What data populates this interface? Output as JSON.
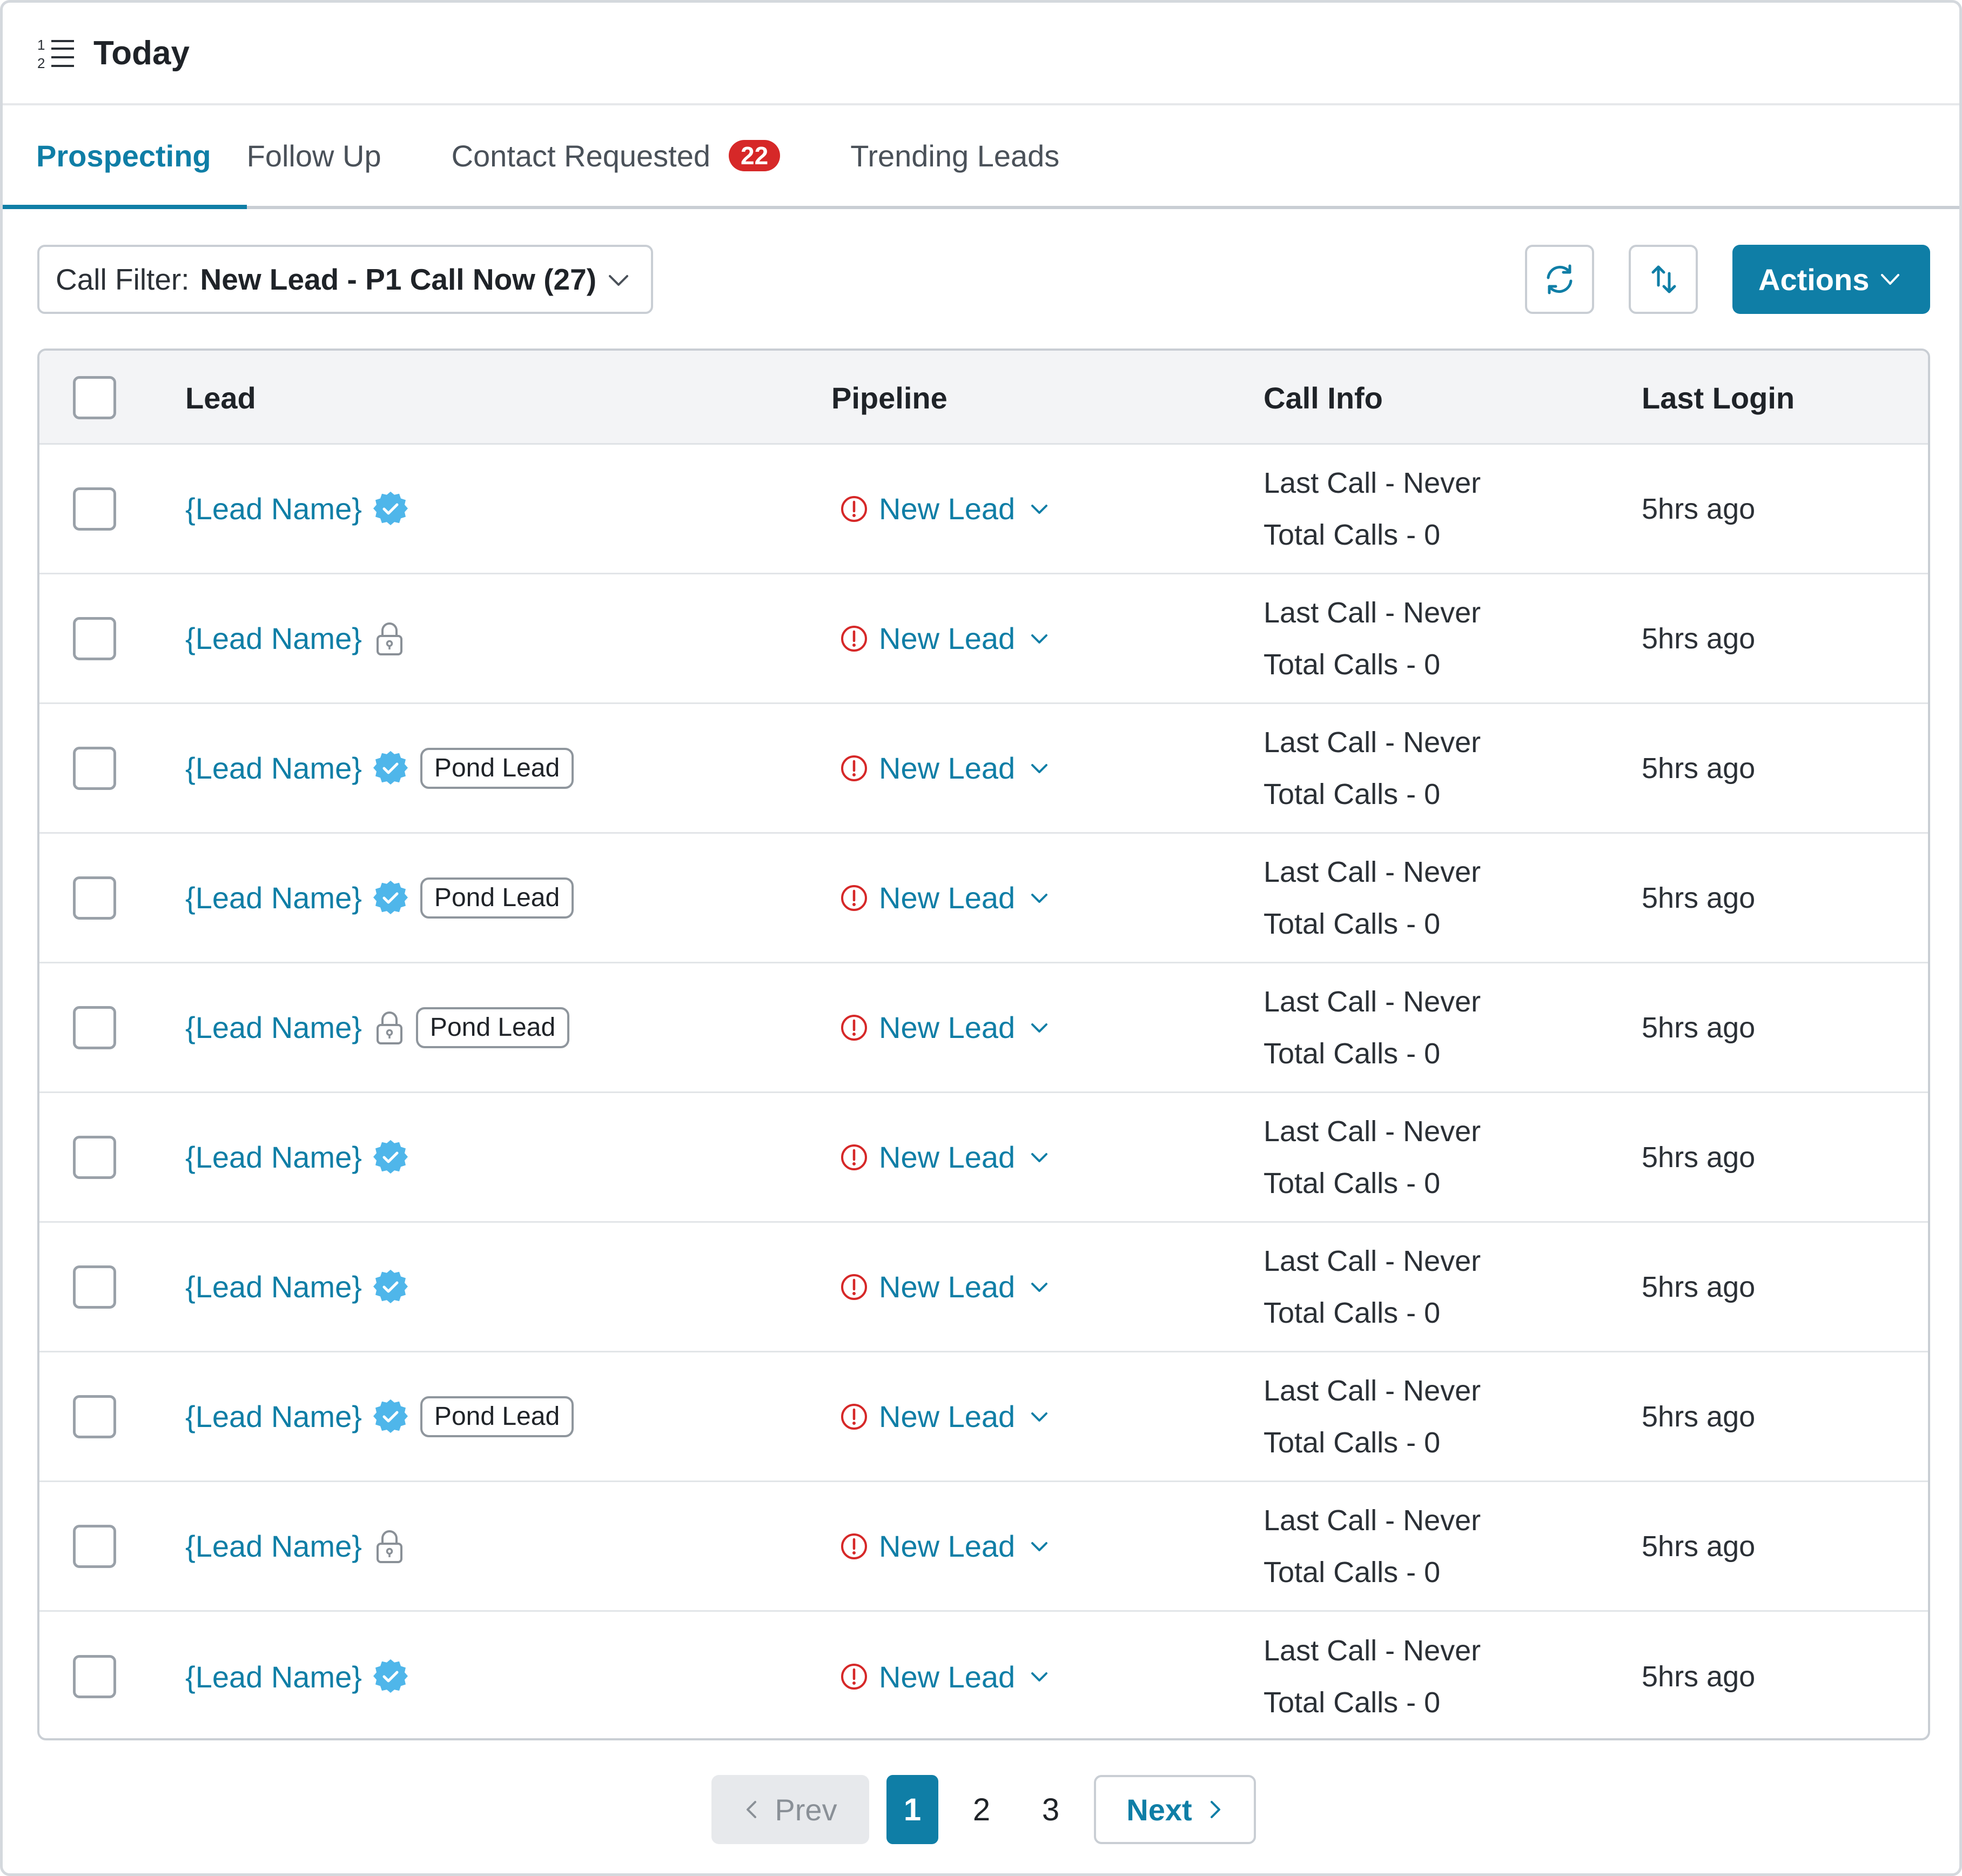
{
  "header": {
    "title": "Today",
    "icon": "ordered-list-icon"
  },
  "tabs": [
    {
      "label": "Prospecting",
      "active": true
    },
    {
      "label": "Follow Up",
      "active": false
    },
    {
      "label": "Contact Requested",
      "active": false,
      "badge": "22"
    },
    {
      "label": "Trending Leads",
      "active": false
    }
  ],
  "toolbar": {
    "filter_label": "Call Filter:",
    "filter_value": "New Lead - P1 Call Now (27)",
    "actions_label": "Actions"
  },
  "table": {
    "columns": [
      "Lead",
      "Pipeline",
      "Call Info",
      "Last Login"
    ],
    "rows": [
      {
        "lead": "{Lead Name}",
        "status_icon": "verified-icon",
        "tag": "",
        "pipeline": "New Lead",
        "last_call": "Last Call - Never",
        "total_calls": "Total Calls - 0",
        "last_login": "5hrs ago"
      },
      {
        "lead": "{Lead Name}",
        "status_icon": "lock-icon",
        "tag": "",
        "pipeline": "New Lead",
        "last_call": "Last Call - Never",
        "total_calls": "Total Calls - 0",
        "last_login": "5hrs ago"
      },
      {
        "lead": "{Lead Name}",
        "status_icon": "verified-icon",
        "tag": "Pond Lead",
        "pipeline": "New Lead",
        "last_call": "Last Call - Never",
        "total_calls": "Total Calls - 0",
        "last_login": "5hrs ago"
      },
      {
        "lead": "{Lead Name}",
        "status_icon": "verified-icon",
        "tag": "Pond Lead",
        "pipeline": "New Lead",
        "last_call": "Last Call - Never",
        "total_calls": "Total Calls - 0",
        "last_login": "5hrs ago"
      },
      {
        "lead": "{Lead Name}",
        "status_icon": "lock-icon",
        "tag": "Pond Lead",
        "pipeline": "New Lead",
        "last_call": "Last Call - Never",
        "total_calls": "Total Calls - 0",
        "last_login": "5hrs ago"
      },
      {
        "lead": "{Lead Name}",
        "status_icon": "verified-icon",
        "tag": "",
        "pipeline": "New Lead",
        "last_call": "Last Call - Never",
        "total_calls": "Total Calls - 0",
        "last_login": "5hrs ago"
      },
      {
        "lead": "{Lead Name}",
        "status_icon": "verified-icon",
        "tag": "",
        "pipeline": "New Lead",
        "last_call": "Last Call - Never",
        "total_calls": "Total Calls - 0",
        "last_login": "5hrs ago"
      },
      {
        "lead": "{Lead Name}",
        "status_icon": "verified-icon",
        "tag": "Pond Lead",
        "pipeline": "New Lead",
        "last_call": "Last Call - Never",
        "total_calls": "Total Calls - 0",
        "last_login": "5hrs ago"
      },
      {
        "lead": "{Lead Name}",
        "status_icon": "lock-icon",
        "tag": "",
        "pipeline": "New Lead",
        "last_call": "Last Call - Never",
        "total_calls": "Total Calls - 0",
        "last_login": "5hrs ago"
      },
      {
        "lead": "{Lead Name}",
        "status_icon": "verified-icon",
        "tag": "",
        "pipeline": "New Lead",
        "last_call": "Last Call - Never",
        "total_calls": "Total Calls - 0",
        "last_login": "5hrs ago"
      }
    ]
  },
  "pagination": {
    "prev_label": "Prev",
    "pages": [
      "1",
      "2",
      "3"
    ],
    "current": "1",
    "next_label": "Next"
  },
  "colors": {
    "accent": "#0f7ea6",
    "badge": "#d62828",
    "verified": "#4fb6ea",
    "alert": "#d62828"
  }
}
